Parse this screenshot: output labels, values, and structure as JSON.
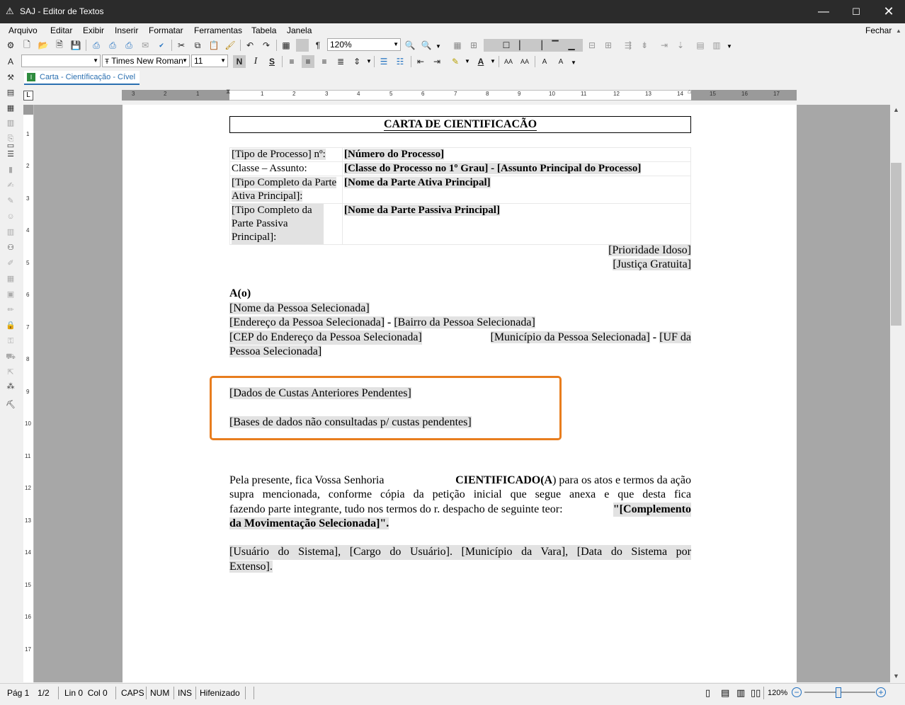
{
  "window": {
    "title": "SAJ - Editor de Textos"
  },
  "menu": {
    "items": [
      "Arquivo",
      "Editar",
      "Exibir",
      "Inserir",
      "Formatar",
      "Ferramentas",
      "Tabela",
      "Janela"
    ],
    "close_label": "Fechar"
  },
  "toolbar": {
    "zoom": "120%",
    "font_name": "Times New Roman",
    "font_size": "11",
    "bold": "N",
    "italic": "I",
    "underline": "S"
  },
  "tab": {
    "label": "Carta - Científicação - Cível",
    "icon": "I"
  },
  "ruler": {
    "h_labels": [
      "3",
      "2",
      "1",
      "1",
      "2",
      "3",
      "4",
      "5",
      "6",
      "7",
      "8",
      "9",
      "10",
      "11",
      "12",
      "13",
      "14",
      "15",
      "16",
      "17"
    ],
    "v_labels": [
      "1",
      "2",
      "3",
      "4",
      "5",
      "6",
      "7",
      "8",
      "9",
      "10",
      "11",
      "12",
      "13",
      "14",
      "15",
      "16",
      "17"
    ]
  },
  "document": {
    "heading": "CARTA DE CIENTIFICACÃO",
    "table": [
      {
        "label": "[Tipo de Processo] nº:",
        "value": "[Número do Processo]"
      },
      {
        "label": "Classe – Assunto:",
        "value": "[Classe do Processo no 1º Grau] - [Assunto Principal do Processo]"
      },
      {
        "label": "[Tipo Completo da Parte Ativa Principal]:",
        "value": "[Nome da Parte Ativa Principal]"
      },
      {
        "label": "[Tipo Completo da Parte Passiva Principal]:",
        "value": "[Nome da Parte Passiva Principal]"
      }
    ],
    "priority": "[Prioridade Idoso]",
    "justice": "[Justiça Gratuita]",
    "to_label": "A(o)",
    "recipient_name": "[Nome da Pessoa Selecionada]",
    "address_line": "[Endereço da Pessoa Selecionada]",
    "address_sep": "-",
    "neighborhood": "[Bairro da Pessoa Selecionada]",
    "cep": "[CEP do Endereço da Pessoa Selecionada]",
    "city": "[Município da Pessoa Selecionada]",
    "uf_sep": "-",
    "uf_part1": "[UF da",
    "uf_part2": "Pessoa Selecionada]",
    "costs_pending": "[Dados de Custas Anteriores Pendentes]",
    "bases_not_consulted": "[Bases de dados não consultadas p/ custas pendentes]",
    "body_p1_a": "Pela presente, fica Vossa Senhoria",
    "body_p1_bold": "CIENTIFICADO(A",
    "body_p1_b": ") para os atos e termos da ação",
    "body_p1_line2": "supra mencionada, conforme cópia da petição inicial que segue anexa e que desta fica",
    "body_p1_line3": "fazendo parte integrante, tudo nos termos do r. despacho de seguinte teor:",
    "body_p1_quote_a": "\"[Complemento",
    "body_p1_quote_b": "da Movimentação Selecionada]\".",
    "footer_line1": "[Usuário do Sistema], [Cargo do Usuário]. [Município da Vara], [Data do Sistema por",
    "footer_line2": "Extenso]."
  },
  "status": {
    "page": "Pág 1",
    "pages": "1/2",
    "position": "Lin 0  Col 0",
    "caps": "CAPS",
    "num": "NUM",
    "ins": "INS",
    "hyphen": "Hifenizado",
    "zoom": "120%"
  },
  "colors": {
    "highlight_box": "#e87d1e",
    "title_bar": "#2b2b2b",
    "tab_text": "#2a6fb0"
  }
}
